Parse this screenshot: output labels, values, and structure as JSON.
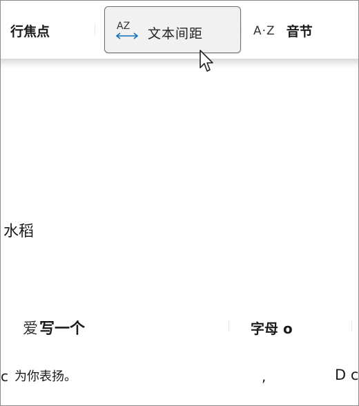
{
  "toolbar": {
    "line_focus_label": "行焦点",
    "text_spacing": {
      "icon_text": "AZ",
      "label": "文本间距"
    },
    "syllables": {
      "icon_text": "A·Z",
      "label": "音节"
    }
  },
  "content": {
    "word_1": "水稻",
    "line_2_left_a": "爱",
    "line_2_left_b": "写一个",
    "line_2_right": "字母 o",
    "line_3_left_a": "c",
    "line_3_left_b": "为你表扬。",
    "line_3_mid": ",",
    "line_3_right": "D c"
  },
  "colors": {
    "accent": "#0f6cbd",
    "button_border": "#6e6e6e",
    "button_bg": "#f1f1f1"
  }
}
